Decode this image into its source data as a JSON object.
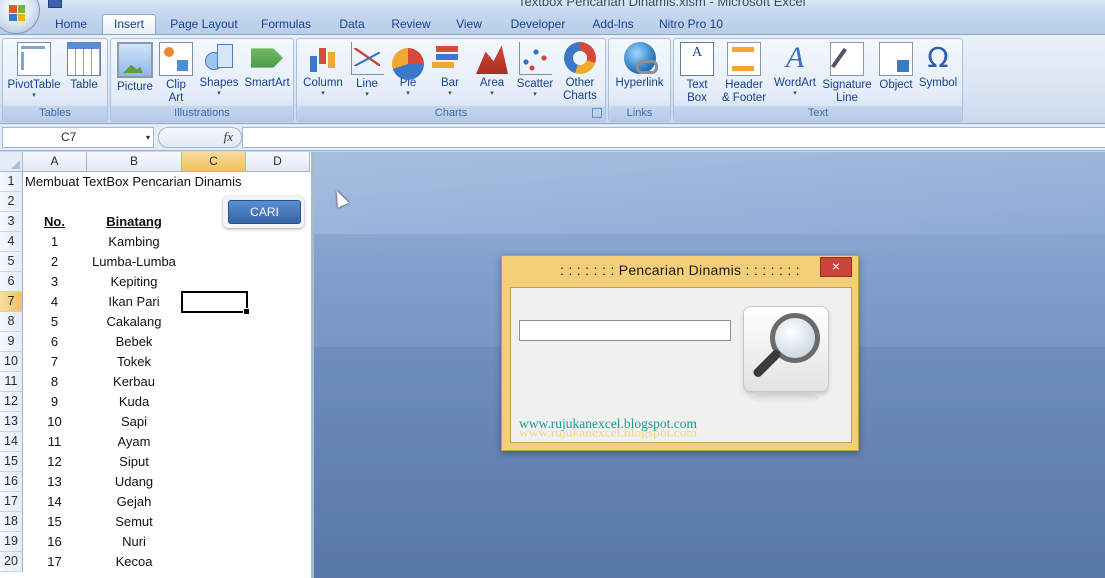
{
  "window": {
    "title": "Textbox Pencarian Dinamis.xlsm - Microsoft Excel"
  },
  "tabs": [
    "Home",
    "Insert",
    "Page Layout",
    "Formulas",
    "Data",
    "Review",
    "View",
    "Developer",
    "Add-Ins",
    "Nitro Pro 10"
  ],
  "active_tab": "Insert",
  "ribbon": {
    "tables": {
      "label": "Tables",
      "pivottable": "PivotTable",
      "table": "Table"
    },
    "illustrations": {
      "label": "Illustrations",
      "picture": "Picture",
      "clip_art_1": "Clip",
      "clip_art_2": "Art",
      "shapes": "Shapes",
      "smartart": "SmartArt"
    },
    "charts": {
      "label": "Charts",
      "column": "Column",
      "line": "Line",
      "pie": "Pie",
      "bar": "Bar",
      "area": "Area",
      "scatter": "Scatter",
      "other_1": "Other",
      "other_2": "Charts"
    },
    "links": {
      "label": "Links",
      "hyperlink": "Hyperlink"
    },
    "text": {
      "label": "Text",
      "textbox_1": "Text",
      "textbox_2": "Box",
      "header_1": "Header",
      "header_2": "& Footer",
      "wordart": "WordArt",
      "signature_1": "Signature",
      "signature_2": "Line",
      "object": "Object",
      "symbol": "Symbol"
    }
  },
  "icons": {
    "textbox_glyph": "A",
    "wordart_glyph": "A",
    "symbol_glyph": "Ω",
    "dropdown_glyph": "▾",
    "fx_glyph": "fx",
    "close_glyph": "×"
  },
  "formula_bar": {
    "name_box": "C7",
    "formula": ""
  },
  "sheet": {
    "columns": [
      "A",
      "B",
      "C",
      "D"
    ],
    "selected_column": "C",
    "selected_row": "7",
    "rows": [
      "1",
      "2",
      "3",
      "4",
      "5",
      "6",
      "7",
      "8",
      "9",
      "10",
      "11",
      "12",
      "13",
      "14",
      "15",
      "16",
      "17",
      "18",
      "19",
      "20"
    ],
    "title": "Membuat TextBox Pencarian Dinamis",
    "header_no": "No.",
    "header_binatang": "Binatang",
    "button_cari": "CARI",
    "data": [
      {
        "no": "1",
        "animal": "Kambing"
      },
      {
        "no": "2",
        "animal": "Lumba-Lumba"
      },
      {
        "no": "3",
        "animal": "Kepiting"
      },
      {
        "no": "4",
        "animal": "Ikan Pari"
      },
      {
        "no": "5",
        "animal": "Cakalang"
      },
      {
        "no": "6",
        "animal": "Bebek"
      },
      {
        "no": "7",
        "animal": "Tokek"
      },
      {
        "no": "8",
        "animal": "Kerbau"
      },
      {
        "no": "9",
        "animal": "Kuda"
      },
      {
        "no": "10",
        "animal": "Sapi"
      },
      {
        "no": "11",
        "animal": "Ayam"
      },
      {
        "no": "12",
        "animal": "Siput"
      },
      {
        "no": "13",
        "animal": "Udang"
      },
      {
        "no": "14",
        "animal": "Gejah"
      },
      {
        "no": "15",
        "animal": "Semut"
      },
      {
        "no": "16",
        "animal": "Nuri"
      },
      {
        "no": "17",
        "animal": "Kecoa"
      }
    ]
  },
  "dialog": {
    "title": ": : : : : : :   Pencarian Dinamis : : : : : : :",
    "search_value": "",
    "website": "www.rujukanexcel.blogspot.com"
  },
  "colors": {
    "dialog_frame": "#f3cf79",
    "close_button": "#c9443a",
    "cari_button": "#3d6db3",
    "website_text": "#1a9b8f",
    "selected_header": "#f1c15f"
  }
}
